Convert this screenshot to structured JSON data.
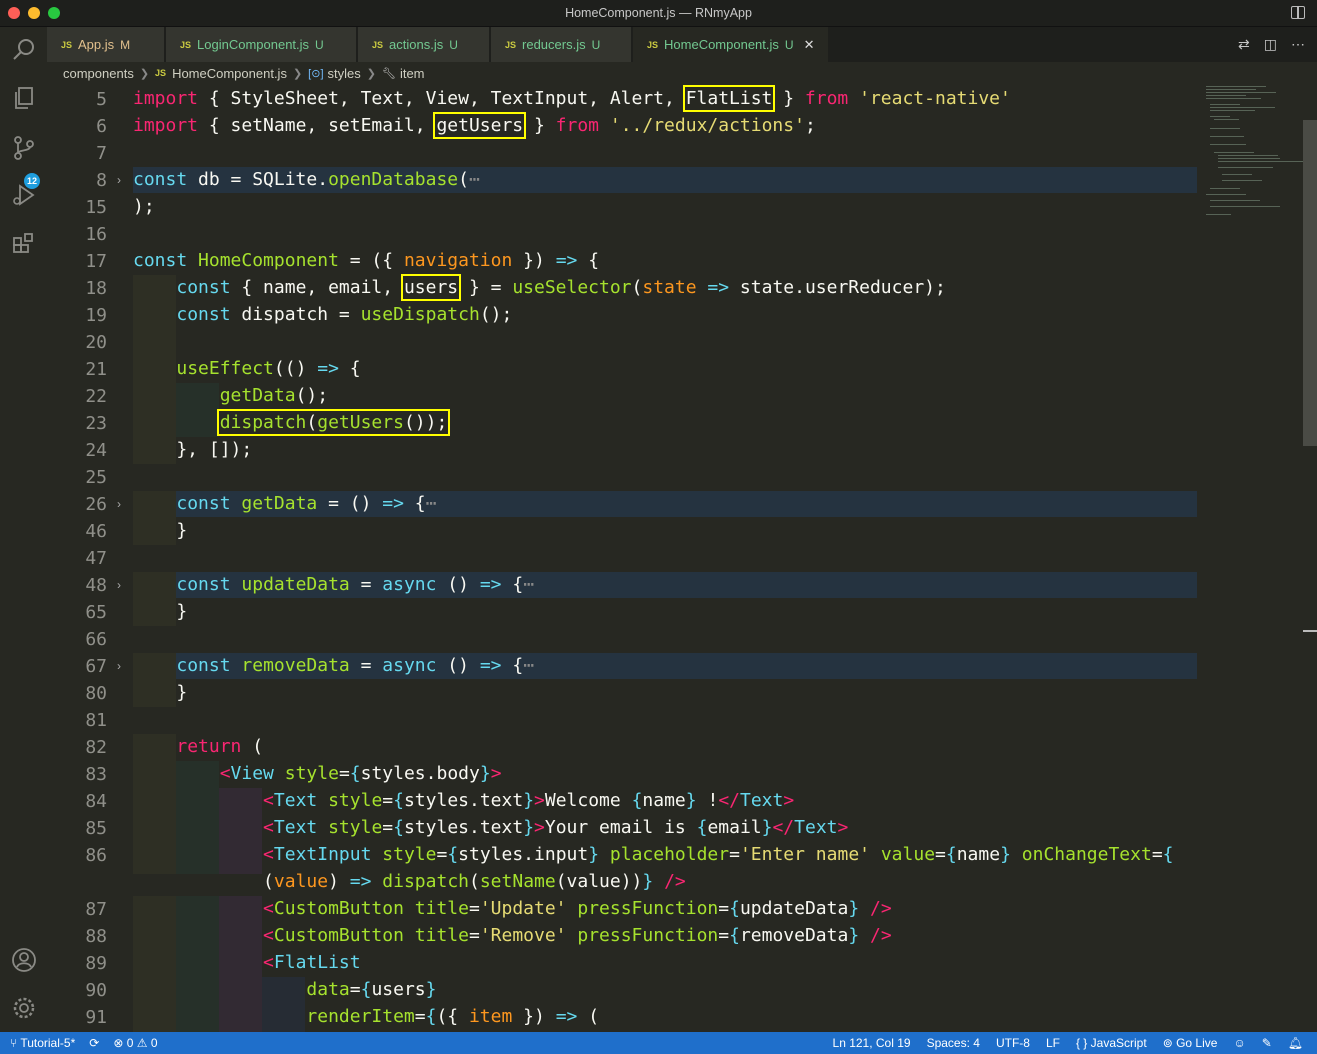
{
  "window": {
    "title": "HomeComponent.js — RNmyApp"
  },
  "activity_bar": {
    "scm_badge": "12"
  },
  "tabs": [
    {
      "label": "App.js",
      "status": "M"
    },
    {
      "label": "LoginComponent.js",
      "status": "U"
    },
    {
      "label": "actions.js",
      "status": "U"
    },
    {
      "label": "reducers.js",
      "status": "U"
    },
    {
      "label": "HomeComponent.js",
      "status": "U"
    }
  ],
  "tab_js_label": "JS",
  "breadcrumb": {
    "folder": "components",
    "file": "HomeComponent.js",
    "symbol1": "styles",
    "symbol2": "item"
  },
  "line_numbers": [
    "5",
    "6",
    "7",
    "8",
    "15",
    "16",
    "17",
    "18",
    "19",
    "20",
    "21",
    "22",
    "23",
    "24",
    "25",
    "26",
    "46",
    "47",
    "48",
    "65",
    "66",
    "67",
    "80",
    "81",
    "82",
    "83",
    "84",
    "85",
    "86",
    "",
    "87",
    "88",
    "89",
    "90",
    "91"
  ],
  "statusbar": {
    "branch": "Tutorial-5*",
    "errors": "0",
    "warnings": "0",
    "position": "Ln 121, Col 19",
    "spaces": "Spaces: 4",
    "encoding": "UTF-8",
    "eol": "LF",
    "language": "JavaScript",
    "golive": "Go Live"
  }
}
